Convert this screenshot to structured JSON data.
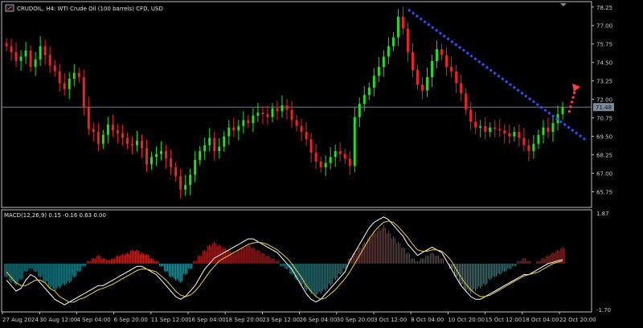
{
  "header": {
    "title": "CRUDOIL, H4:  WTI Crude Oil (100 barrels) CFD, USD",
    "icon": "chart-window-icon"
  },
  "price_scale": {
    "labels": [
      "78.25",
      "77.00",
      "75.75",
      "74.50",
      "73.25",
      "72.00",
      "70.75",
      "69.50",
      "68.25",
      "67.00",
      "65.75"
    ],
    "min": 64.8,
    "max": 78.4,
    "current": "71.48"
  },
  "macd": {
    "label": "MACD(12,26,9) 0.15 -0.16 0.63 0.00",
    "scale_top": "1.87",
    "scale_bottom": "-1.70"
  },
  "time_axis": {
    "labels": [
      "27 Aug 2024",
      "30 Aug 12:00",
      "4 Sep 04:00",
      "6 Sep 20:00",
      "11 Sep 12:00",
      "16 Sep 04:00",
      "18 Sep 20:00",
      "23 Sep 12:00",
      "26 Sep 04:00",
      "30 Sep 20:00",
      "3 Oct 12:00",
      "8 Oct 04:00",
      "10 Oct 20:00",
      "15 Oct 12:00",
      "18 Oct 04:00",
      "22 Oct 20:00"
    ]
  },
  "colors": {
    "background": "#000000",
    "bull": "#22dd22",
    "bear": "#ee2222",
    "trendline": "#2f4fff",
    "arrow": "#ff3a4a",
    "grid": "#c0c0c0",
    "price_line": "#6a7ea8",
    "macd_pos": "#c42a2a",
    "macd_neg": "#20a6b0",
    "macd_line": "#ffffff",
    "signal_line": "#e8d040"
  },
  "series_close": [
    75.6,
    75.2,
    74.6,
    74.9,
    75.3,
    74.2,
    74.7,
    75.6,
    75.0,
    74.3,
    73.9,
    73.1,
    72.7,
    73.4,
    73.8,
    73.5,
    71.5,
    70.0,
    69.8,
    69.0,
    69.6,
    70.3,
    69.9,
    69.7,
    69.4,
    69.0,
    68.9,
    69.2,
    68.7,
    67.6,
    68.1,
    68.3,
    68.5,
    68.0,
    67.4,
    66.8,
    65.9,
    66.2,
    66.9,
    67.9,
    68.5,
    68.9,
    69.4,
    68.5,
    68.8,
    69.5,
    70.1,
    69.9,
    70.2,
    70.6,
    70.4,
    70.9,
    71.1,
    71.0,
    70.8,
    71.4,
    71.2,
    71.6,
    71.3,
    70.6,
    70.2,
    69.8,
    69.3,
    68.4,
    67.8,
    67.4,
    67.7,
    68.1,
    68.5,
    68.3,
    68.0,
    67.5,
    70.8,
    71.7,
    72.3,
    72.8,
    73.6,
    74.2,
    74.9,
    75.6,
    76.2,
    77.6,
    76.8,
    75.2,
    74.0,
    73.0,
    72.6,
    73.5,
    74.6,
    75.4,
    75.0,
    74.2,
    73.9,
    73.1,
    72.4,
    71.3,
    70.5,
    70.1,
    70.2,
    69.8,
    70.1,
    70.0,
    69.9,
    69.7,
    69.5,
    69.8,
    69.4,
    68.9,
    68.5,
    69.0,
    69.6,
    70.1,
    69.8,
    70.4,
    71.0,
    71.48
  ],
  "macd_hist": [
    -0.5,
    -0.7,
    -0.8,
    -0.6,
    -0.3,
    -0.2,
    -0.3,
    -0.5,
    -0.7,
    -0.9,
    -1.0,
    -0.9,
    -0.8,
    -0.7,
    -0.5,
    -0.3,
    -0.1,
    0.1,
    0.2,
    0.3,
    0.2,
    0.15,
    0.2,
    0.3,
    0.35,
    0.4,
    0.5,
    0.5,
    0.4,
    0.35,
    0.2,
    0.1,
    -0.1,
    -0.3,
    -0.5,
    -0.6,
    -0.7,
    -0.4,
    -0.2,
    0.1,
    0.3,
    0.5,
    0.7,
    0.8,
    0.7,
    0.6,
    0.5,
    0.4,
    0.5,
    0.6,
    0.7,
    0.6,
    0.5,
    0.4,
    0.3,
    0.2,
    0.1,
    -0.1,
    -0.2,
    -0.4,
    -0.6,
    -0.8,
    -1.0,
    -1.1,
    -1.2,
    -1.1,
    -1.0,
    -0.8,
    -0.6,
    -0.4,
    -0.2,
    0.2,
    0.4,
    0.6,
    0.8,
    1.0,
    1.2,
    1.3,
    1.4,
    1.2,
    1.0,
    0.8,
    0.6,
    0.4,
    0.2,
    0.1,
    0.2,
    0.3,
    0.4,
    0.3,
    0.2,
    0.0,
    -0.2,
    -0.5,
    -0.8,
    -1.0,
    -1.1,
    -1.0,
    -0.9,
    -0.8,
    -0.6,
    -0.5,
    -0.4,
    -0.3,
    -0.2,
    -0.1,
    0.1,
    0.2,
    0.1,
    0.0,
    0.1,
    0.2,
    0.3,
    0.4,
    0.5,
    0.6
  ],
  "macd_line": [
    -0.6,
    -0.8,
    -1.0,
    -0.9,
    -0.6,
    -0.4,
    -0.5,
    -0.7,
    -0.9,
    -1.1,
    -1.3,
    -1.4,
    -1.5,
    -1.4,
    -1.3,
    -1.2,
    -1.1,
    -1.0,
    -0.9,
    -0.8,
    -0.8,
    -0.7,
    -0.6,
    -0.5,
    -0.4,
    -0.3,
    -0.2,
    -0.1,
    -0.1,
    -0.2,
    -0.3,
    -0.4,
    -0.6,
    -0.8,
    -1.0,
    -1.2,
    -1.3,
    -1.2,
    -1.0,
    -0.8,
    -0.5,
    -0.2,
    0.0,
    0.2,
    0.3,
    0.4,
    0.5,
    0.6,
    0.7,
    0.8,
    0.9,
    0.9,
    0.8,
    0.7,
    0.6,
    0.5,
    0.4,
    0.2,
    0.0,
    -0.2,
    -0.5,
    -0.8,
    -1.1,
    -1.3,
    -1.4,
    -1.3,
    -1.1,
    -0.9,
    -0.7,
    -0.5,
    -0.3,
    0.1,
    0.4,
    0.7,
    1.0,
    1.3,
    1.5,
    1.6,
    1.7,
    1.6,
    1.4,
    1.2,
    1.0,
    0.7,
    0.5,
    0.3,
    0.4,
    0.5,
    0.6,
    0.5,
    0.4,
    0.1,
    -0.2,
    -0.5,
    -0.8,
    -1.0,
    -1.2,
    -1.3,
    -1.3,
    -1.2,
    -1.1,
    -1.0,
    -0.9,
    -0.8,
    -0.7,
    -0.6,
    -0.5,
    -0.4,
    -0.4,
    -0.3,
    -0.2,
    -0.1,
    0.0,
    0.05,
    0.1,
    0.15
  ],
  "signal_line": [
    -0.3,
    -0.5,
    -0.7,
    -0.8,
    -0.8,
    -0.7,
    -0.6,
    -0.6,
    -0.7,
    -0.9,
    -1.0,
    -1.2,
    -1.3,
    -1.4,
    -1.4,
    -1.3,
    -1.25,
    -1.15,
    -1.05,
    -0.95,
    -0.9,
    -0.82,
    -0.75,
    -0.65,
    -0.55,
    -0.45,
    -0.35,
    -0.25,
    -0.2,
    -0.2,
    -0.25,
    -0.3,
    -0.45,
    -0.6,
    -0.8,
    -1.0,
    -1.15,
    -1.2,
    -1.15,
    -1.0,
    -0.8,
    -0.55,
    -0.3,
    -0.1,
    0.1,
    0.2,
    0.3,
    0.4,
    0.5,
    0.6,
    0.7,
    0.75,
    0.78,
    0.75,
    0.7,
    0.6,
    0.5,
    0.35,
    0.2,
    0.0,
    -0.25,
    -0.5,
    -0.8,
    -1.0,
    -1.2,
    -1.3,
    -1.25,
    -1.1,
    -0.95,
    -0.75,
    -0.55,
    -0.3,
    0.0,
    0.3,
    0.6,
    0.9,
    1.15,
    1.35,
    1.5,
    1.55,
    1.5,
    1.35,
    1.15,
    0.95,
    0.7,
    0.5,
    0.45,
    0.45,
    0.5,
    0.5,
    0.45,
    0.3,
    0.1,
    -0.2,
    -0.5,
    -0.75,
    -0.95,
    -1.1,
    -1.2,
    -1.2,
    -1.15,
    -1.05,
    -0.95,
    -0.85,
    -0.75,
    -0.65,
    -0.55,
    -0.45,
    -0.4,
    -0.35,
    -0.3,
    -0.2,
    -0.1,
    0.0,
    0.05,
    0.1
  ]
}
